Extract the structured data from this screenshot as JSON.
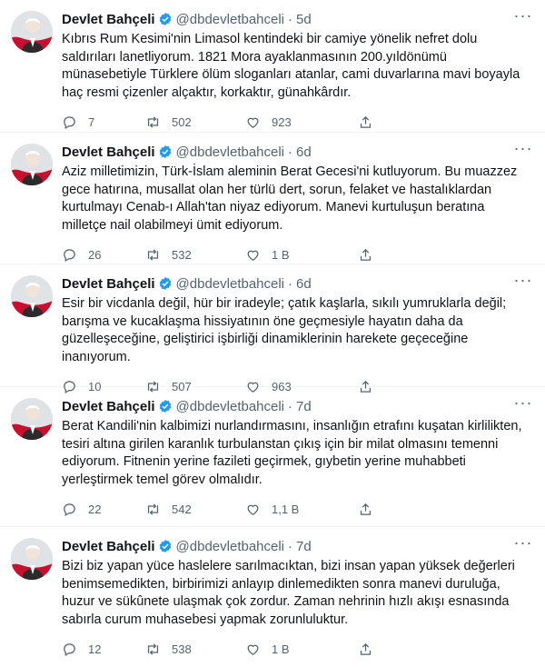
{
  "colors": {
    "verified": "#1d9bf0",
    "text_secondary": "#536471",
    "divider": "#eff3f4"
  },
  "icons": {
    "verified": "verified-badge-icon",
    "more": "more-icon",
    "reply": "reply-icon",
    "retweet": "retweet-icon",
    "like": "like-icon",
    "share": "share-icon"
  },
  "tweets": [
    {
      "name": "Devlet Bahçeli",
      "handle": "@dbdevletbahceli",
      "dot": "·",
      "time": "5d",
      "text": "Kıbrıs Rum Kesimi'nin Limasol kentindeki bir camiye yönelik nefret dolu saldırıları lanetliyorum. 1821 Mora ayaklanmasının 200.yıldönümü münasebetiyle Türklere ölüm sloganları atanlar, cami duvarlarına mavi boyayla haç resmi çizenler alçaktır, korkaktır, günahkârdır.",
      "replies": "7",
      "retweets": "502",
      "likes": "923"
    },
    {
      "name": "Devlet Bahçeli",
      "handle": "@dbdevletbahceli",
      "dot": "·",
      "time": "6d",
      "text": "Aziz milletimizin, Türk-İslam aleminin Berat Gecesi'ni kutluyorum. Bu muazzez gece hatırına, musallat olan her türlü dert, sorun, felaket ve hastalıklardan kurtulmayı Cenab-ı Allah'tan niyaz ediyorum. Manevi kurtuluşun beratına milletçe nail olabilmeyi ümit ediyorum.",
      "replies": "26",
      "retweets": "532",
      "likes": "1 B"
    },
    {
      "name": "Devlet Bahçeli",
      "handle": "@dbdevletbahceli",
      "dot": "·",
      "time": "6d",
      "text": "Esir bir vicdanla değil, hür bir iradeyle; çatık kaşlarla, sıkılı yumruklarla değil; barışma ve kucaklaşma hissiyatının öne geçmesiyle hayatın daha da güzelleşeceğine, geliştirici işbirliği dinamiklerinin harekete geçeceğine inanıyorum.",
      "replies": "10",
      "retweets": "507",
      "likes": "963"
    },
    {
      "name": "Devlet Bahçeli",
      "handle": "@dbdevletbahceli",
      "dot": "·",
      "time": "7d",
      "text": "Berat Kandili'nin kalbimizi nurlandırmasını, insanlığın etrafını kuşatan kirlilikten, tesiri altına girilen karanlık turbulanstan çıkış için bir milat olmasını temenni ediyorum. Fitnenin yerine fazileti geçirmek, gıybetin yerine muhabbeti yerleştirmek temel görev olmalıdır.",
      "replies": "22",
      "retweets": "542",
      "likes": "1,1 B"
    },
    {
      "name": "Devlet Bahçeli",
      "handle": "@dbdevletbahceli",
      "dot": "·",
      "time": "7d",
      "text": "Bizi biz yapan yüce haslelere sarılmacıktan, bizi insan yapan yüksek değerleri benimsemedikten, birbirimizi anlayıp dinlemedikten sonra manevi duruluğa, huzur ve sükûnete ulaşmak çok zordur. Zaman nehrinin hızlı akışı esnasında sabırla curum muhasebesi yapmak zorunluluktur.",
      "replies": "12",
      "retweets": "538",
      "likes": "1 B"
    }
  ]
}
